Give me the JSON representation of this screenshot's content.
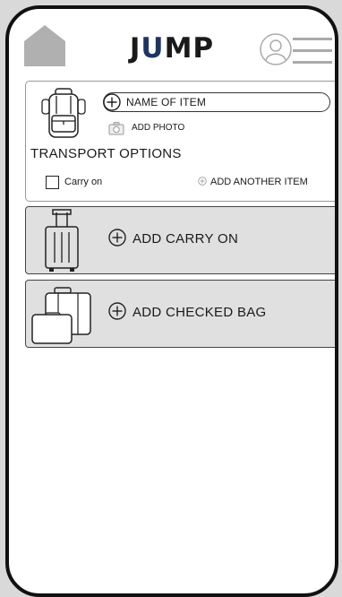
{
  "header": {
    "logo_prefix": "J",
    "logo_mid": "U",
    "logo_suffix": "MP",
    "accent_color": "#1d3563"
  },
  "item_card": {
    "name_placeholder": "NAME OF ITEM",
    "add_photo_label": "ADD PHOTO",
    "transport_title": "TRANSPORT OPTIONS",
    "carry_on_label": "Carry on",
    "carry_on_checked": false,
    "add_another_label": "ADD ANOTHER ITEM"
  },
  "sections": {
    "carry_on_label": "ADD CARRY ON",
    "checked_bag_label": "ADD CHECKED BAG"
  },
  "icons": [
    "home-icon",
    "user-icon",
    "menu-icon",
    "backpack-icon",
    "plus-circle-icon",
    "camera-icon",
    "suitcase-icon",
    "luggage-icon"
  ]
}
